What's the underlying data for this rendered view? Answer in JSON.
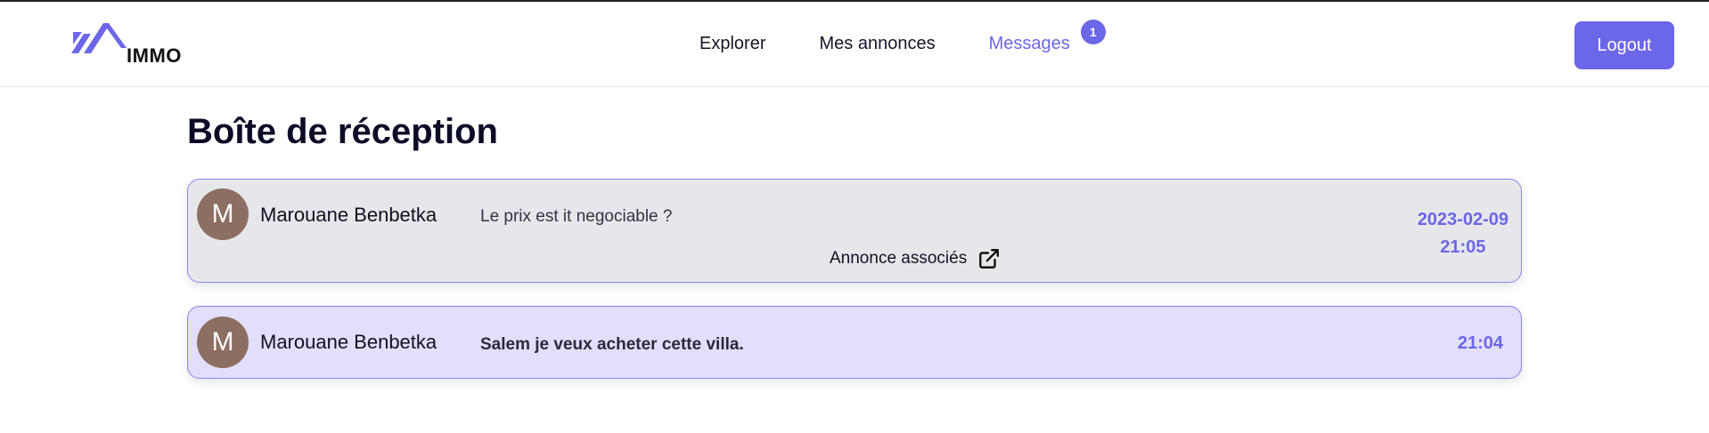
{
  "brand": {
    "logo_text": "IMMO",
    "accent_color": "#6c66e8"
  },
  "nav": {
    "items": [
      {
        "label": "Explorer"
      },
      {
        "label": "Mes annonces"
      },
      {
        "label": "Messages",
        "active": true,
        "badge": "1"
      }
    ]
  },
  "header": {
    "logout_label": "Logout"
  },
  "inbox": {
    "title": "Boîte de réception",
    "messages": [
      {
        "avatar_letter": "M",
        "sender": "Marouane Benbetka",
        "preview": "Le prix est it negociable ?",
        "linked_label": "Annonce associés",
        "linked_icon": "external-link-icon",
        "date": "2023-02-09",
        "time": "21:05",
        "unread": false
      },
      {
        "avatar_letter": "M",
        "sender": "Marouane Benbetka",
        "preview": "Salem je veux acheter cette villa.",
        "time": "21:04",
        "unread": true
      }
    ]
  }
}
